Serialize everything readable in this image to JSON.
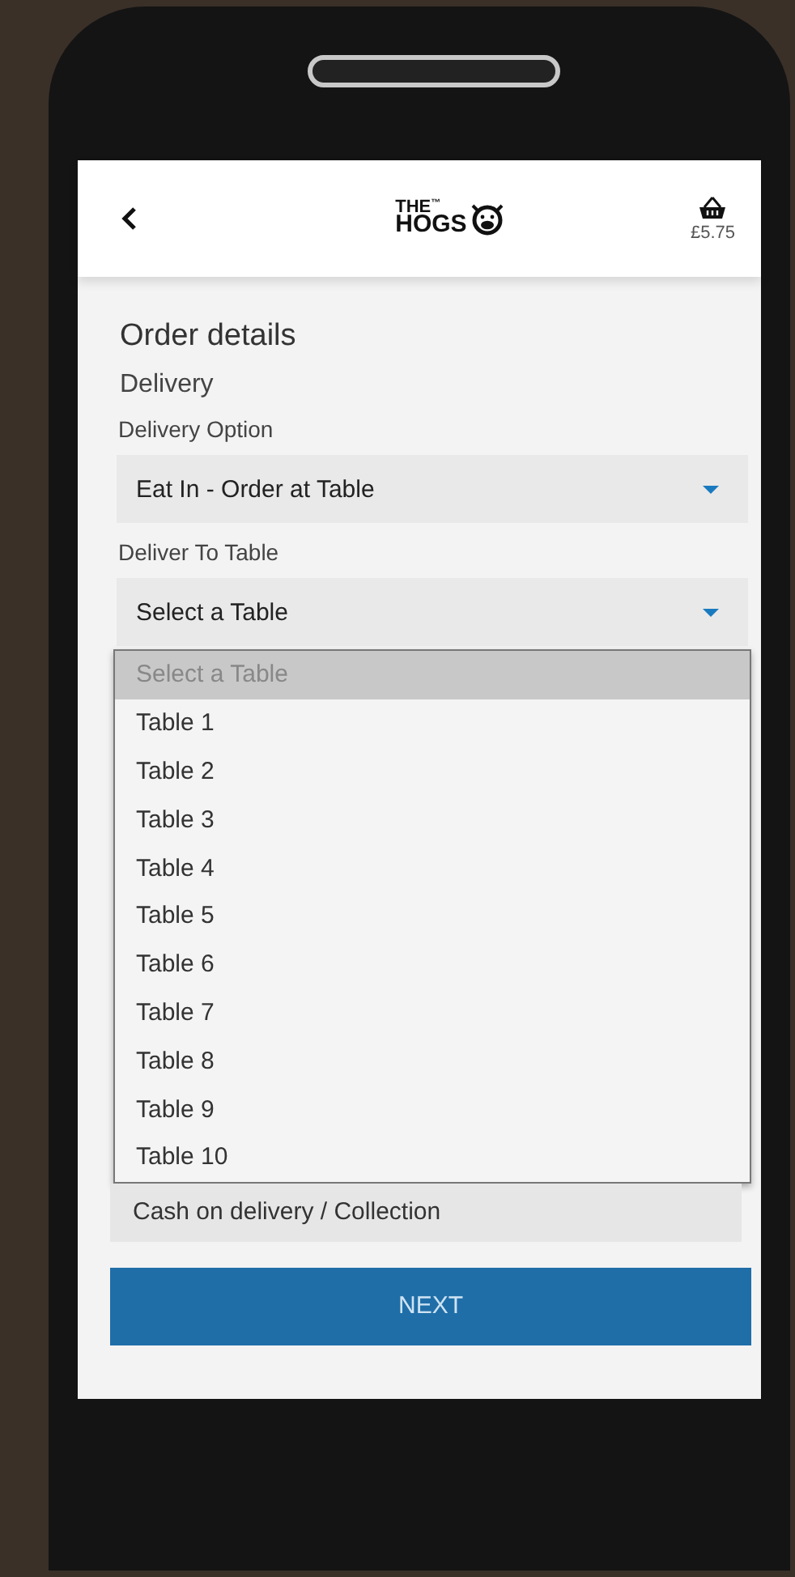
{
  "header": {
    "logo": {
      "line_1": "THE",
      "trademark": "™",
      "line_2": "HOGS"
    },
    "basket_total": "£5.75"
  },
  "page_title": "Order details",
  "section_title": "Delivery",
  "fields": [
    {
      "label": "Delivery Option",
      "value": "Eat In - Order at Table"
    },
    {
      "label": "Deliver To Table",
      "value": "Select a Table"
    }
  ],
  "table_options": [
    {
      "label": "Select a Table",
      "selected": true
    },
    {
      "label": "Table 1",
      "selected": false
    },
    {
      "label": "Table 2",
      "selected": false
    },
    {
      "label": "Table 3",
      "selected": false
    },
    {
      "label": "Table 4",
      "selected": false
    },
    {
      "label": "Table 5",
      "selected": false
    },
    {
      "label": "Table 6",
      "selected": false
    },
    {
      "label": "Table 7",
      "selected": false
    },
    {
      "label": "Table 8",
      "selected": false
    },
    {
      "label": "Table 9",
      "selected": false
    },
    {
      "label": "Table 10",
      "selected": false
    }
  ],
  "payment_value": "Cash on delivery / Collection",
  "next_button": "NEXT"
}
